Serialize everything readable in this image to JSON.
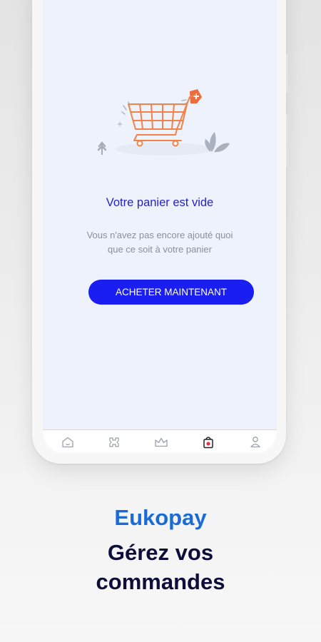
{
  "cart": {
    "empty_title": "Votre panier est vide",
    "empty_line1": "Vous n'avez pas encore ajouté quoi",
    "empty_line2": "que ce soit à votre panier",
    "buy_now_label": "ACHETER MAINTENANT"
  },
  "bottom_nav": {
    "items": [
      {
        "icon": "home-icon",
        "active": false
      },
      {
        "icon": "categories-icon",
        "active": false
      },
      {
        "icon": "crown-icon",
        "active": false
      },
      {
        "icon": "shopping-bag-icon",
        "active": true
      },
      {
        "icon": "user-icon",
        "active": false
      }
    ]
  },
  "caption": {
    "brand": "Eukopay",
    "line1": "Gérez vos",
    "line2": "commandes"
  },
  "colors": {
    "accent": "#1a1ef0",
    "title": "#2323c8",
    "brand": "#1a6bd6",
    "cart_orange": "#f0834a",
    "screen_bg": "#eef2fc"
  }
}
